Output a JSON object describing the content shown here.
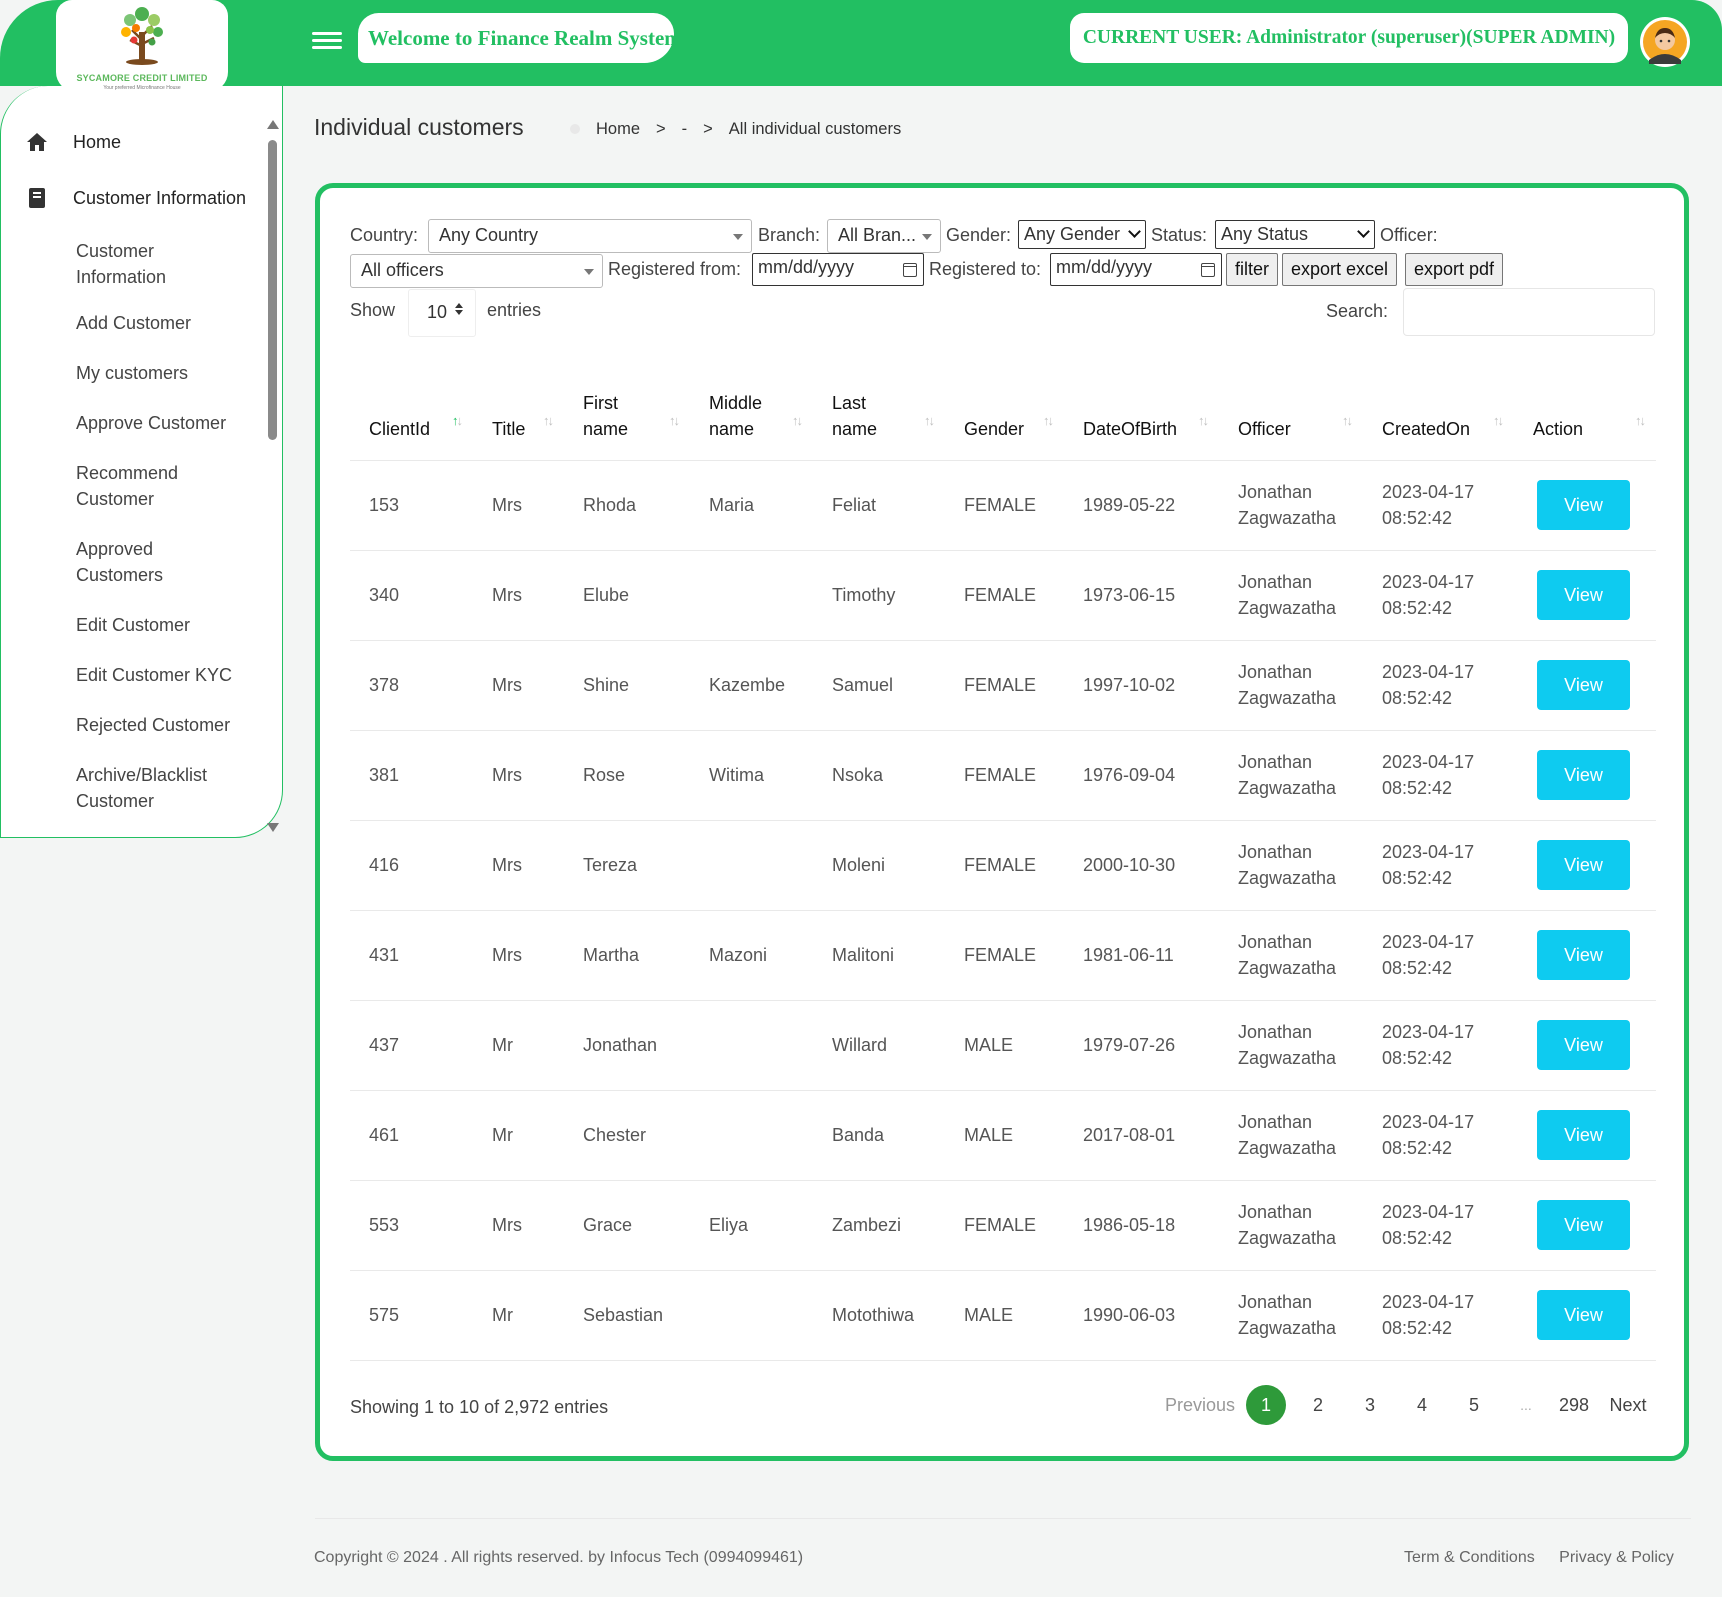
{
  "brand": {
    "company": "SYCAMORE CREDIT LIMITED",
    "tagline": "Your preferred Microfinance House"
  },
  "header": {
    "welcome": "Welcome to Finance Realm System",
    "current_user": "CURRENT USER: Administrator (superuser)(SUPER ADMIN)",
    "accent_color": "#22bf62"
  },
  "sidebar": {
    "home": "Home",
    "section": "Customer Information",
    "items": [
      "Customer Information",
      "Add Customer",
      "My customers",
      "Approve Customer",
      "Recommend Customer",
      "Approved Customers",
      "Edit Customer",
      "Edit Customer KYC",
      "Rejected Customer",
      "Archive/Blacklist Customer"
    ]
  },
  "page": {
    "title": "Individual customers",
    "breadcrumb": [
      "Home",
      ">",
      "-",
      ">",
      "All individual customers"
    ]
  },
  "filters": {
    "country_label": "Country:",
    "country_value": "Any Country",
    "branch_label": "Branch:",
    "branch_value": "All Bran...",
    "gender_label": "Gender:",
    "gender_value": "Any Gender",
    "status_label": "Status:",
    "status_value": "Any Status",
    "officer_label": "Officer:",
    "officer_value": "All officers",
    "reg_from_label": "Registered from:",
    "reg_from_value": "mm/dd/yyyy",
    "reg_to_label": "Registered to:",
    "reg_to_value": "mm/dd/yyyy",
    "filter_btn": "filter",
    "excel_btn": "export excel",
    "pdf_btn": "export pdf",
    "show_label": "Show",
    "show_value": "10",
    "entries_label": "entries",
    "search_label": "Search:"
  },
  "table": {
    "columns": [
      "ClientId",
      "Title",
      "First name",
      "Middle name",
      "Last name",
      "Gender",
      "DateOfBirth",
      "Officer",
      "CreatedOn",
      "Action"
    ],
    "action_label": "View",
    "rows": [
      {
        "id": "153",
        "title": "Mrs",
        "first": "Rhoda",
        "middle": "Maria",
        "last": "Feliat",
        "gender": "FEMALE",
        "dob": "1989-05-22",
        "officer1": "Jonathan",
        "officer2": "Zagwazatha",
        "created1": "2023-04-17",
        "created2": "08:52:42"
      },
      {
        "id": "340",
        "title": "Mrs",
        "first": "Elube",
        "middle": "",
        "last": "Timothy",
        "gender": "FEMALE",
        "dob": "1973-06-15",
        "officer1": "Jonathan",
        "officer2": "Zagwazatha",
        "created1": "2023-04-17",
        "created2": "08:52:42"
      },
      {
        "id": "378",
        "title": "Mrs",
        "first": "Shine",
        "middle": "Kazembe",
        "last": "Samuel",
        "gender": "FEMALE",
        "dob": "1997-10-02",
        "officer1": "Jonathan",
        "officer2": "Zagwazatha",
        "created1": "2023-04-17",
        "created2": "08:52:42"
      },
      {
        "id": "381",
        "title": "Mrs",
        "first": "Rose",
        "middle": "Witima",
        "last": "Nsoka",
        "gender": "FEMALE",
        "dob": "1976-09-04",
        "officer1": "Jonathan",
        "officer2": "Zagwazatha",
        "created1": "2023-04-17",
        "created2": "08:52:42"
      },
      {
        "id": "416",
        "title": "Mrs",
        "first": "Tereza",
        "middle": "",
        "last": "Moleni",
        "gender": "FEMALE",
        "dob": "2000-10-30",
        "officer1": "Jonathan",
        "officer2": "Zagwazatha",
        "created1": "2023-04-17",
        "created2": "08:52:42"
      },
      {
        "id": "431",
        "title": "Mrs",
        "first": "Martha",
        "middle": "Mazoni",
        "last": "Malitoni",
        "gender": "FEMALE",
        "dob": "1981-06-11",
        "officer1": "Jonathan",
        "officer2": "Zagwazatha",
        "created1": "2023-04-17",
        "created2": "08:52:42"
      },
      {
        "id": "437",
        "title": "Mr",
        "first": "Jonathan",
        "middle": "",
        "last": "Willard",
        "gender": "MALE",
        "dob": "1979-07-26",
        "officer1": "Jonathan",
        "officer2": "Zagwazatha",
        "created1": "2023-04-17",
        "created2": "08:52:42"
      },
      {
        "id": "461",
        "title": "Mr",
        "first": "Chester",
        "middle": "",
        "last": "Banda",
        "gender": "MALE",
        "dob": "2017-08-01",
        "officer1": "Jonathan",
        "officer2": "Zagwazatha",
        "created1": "2023-04-17",
        "created2": "08:52:42"
      },
      {
        "id": "553",
        "title": "Mrs",
        "first": "Grace",
        "middle": "Eliya",
        "last": "Zambezi",
        "gender": "FEMALE",
        "dob": "1986-05-18",
        "officer1": "Jonathan",
        "officer2": "Zagwazatha",
        "created1": "2023-04-17",
        "created2": "08:52:42"
      },
      {
        "id": "575",
        "title": "Mr",
        "first": "Sebastian",
        "middle": "",
        "last": "Motothiwa",
        "gender": "MALE",
        "dob": "1990-06-03",
        "officer1": "Jonathan",
        "officer2": "Zagwazatha",
        "created1": "2023-04-17",
        "created2": "08:52:42"
      }
    ]
  },
  "pagination": {
    "summary": "Showing 1 to 10 of 2,972 entries",
    "previous": "Previous",
    "pages": [
      "1",
      "2",
      "3",
      "4",
      "5"
    ],
    "ellipsis": "...",
    "last": "298",
    "next": "Next",
    "active_page": "1"
  },
  "footer": {
    "copyright": "Copyright © 2024 . All rights reserved. by Infocus Tech (0994099461)",
    "terms": "Term & Conditions",
    "privacy": "Privacy & Policy"
  },
  "colors": {
    "primary": "#22bf62",
    "view_button": "#0ecbf0",
    "active_page": "#2e9a3a"
  }
}
